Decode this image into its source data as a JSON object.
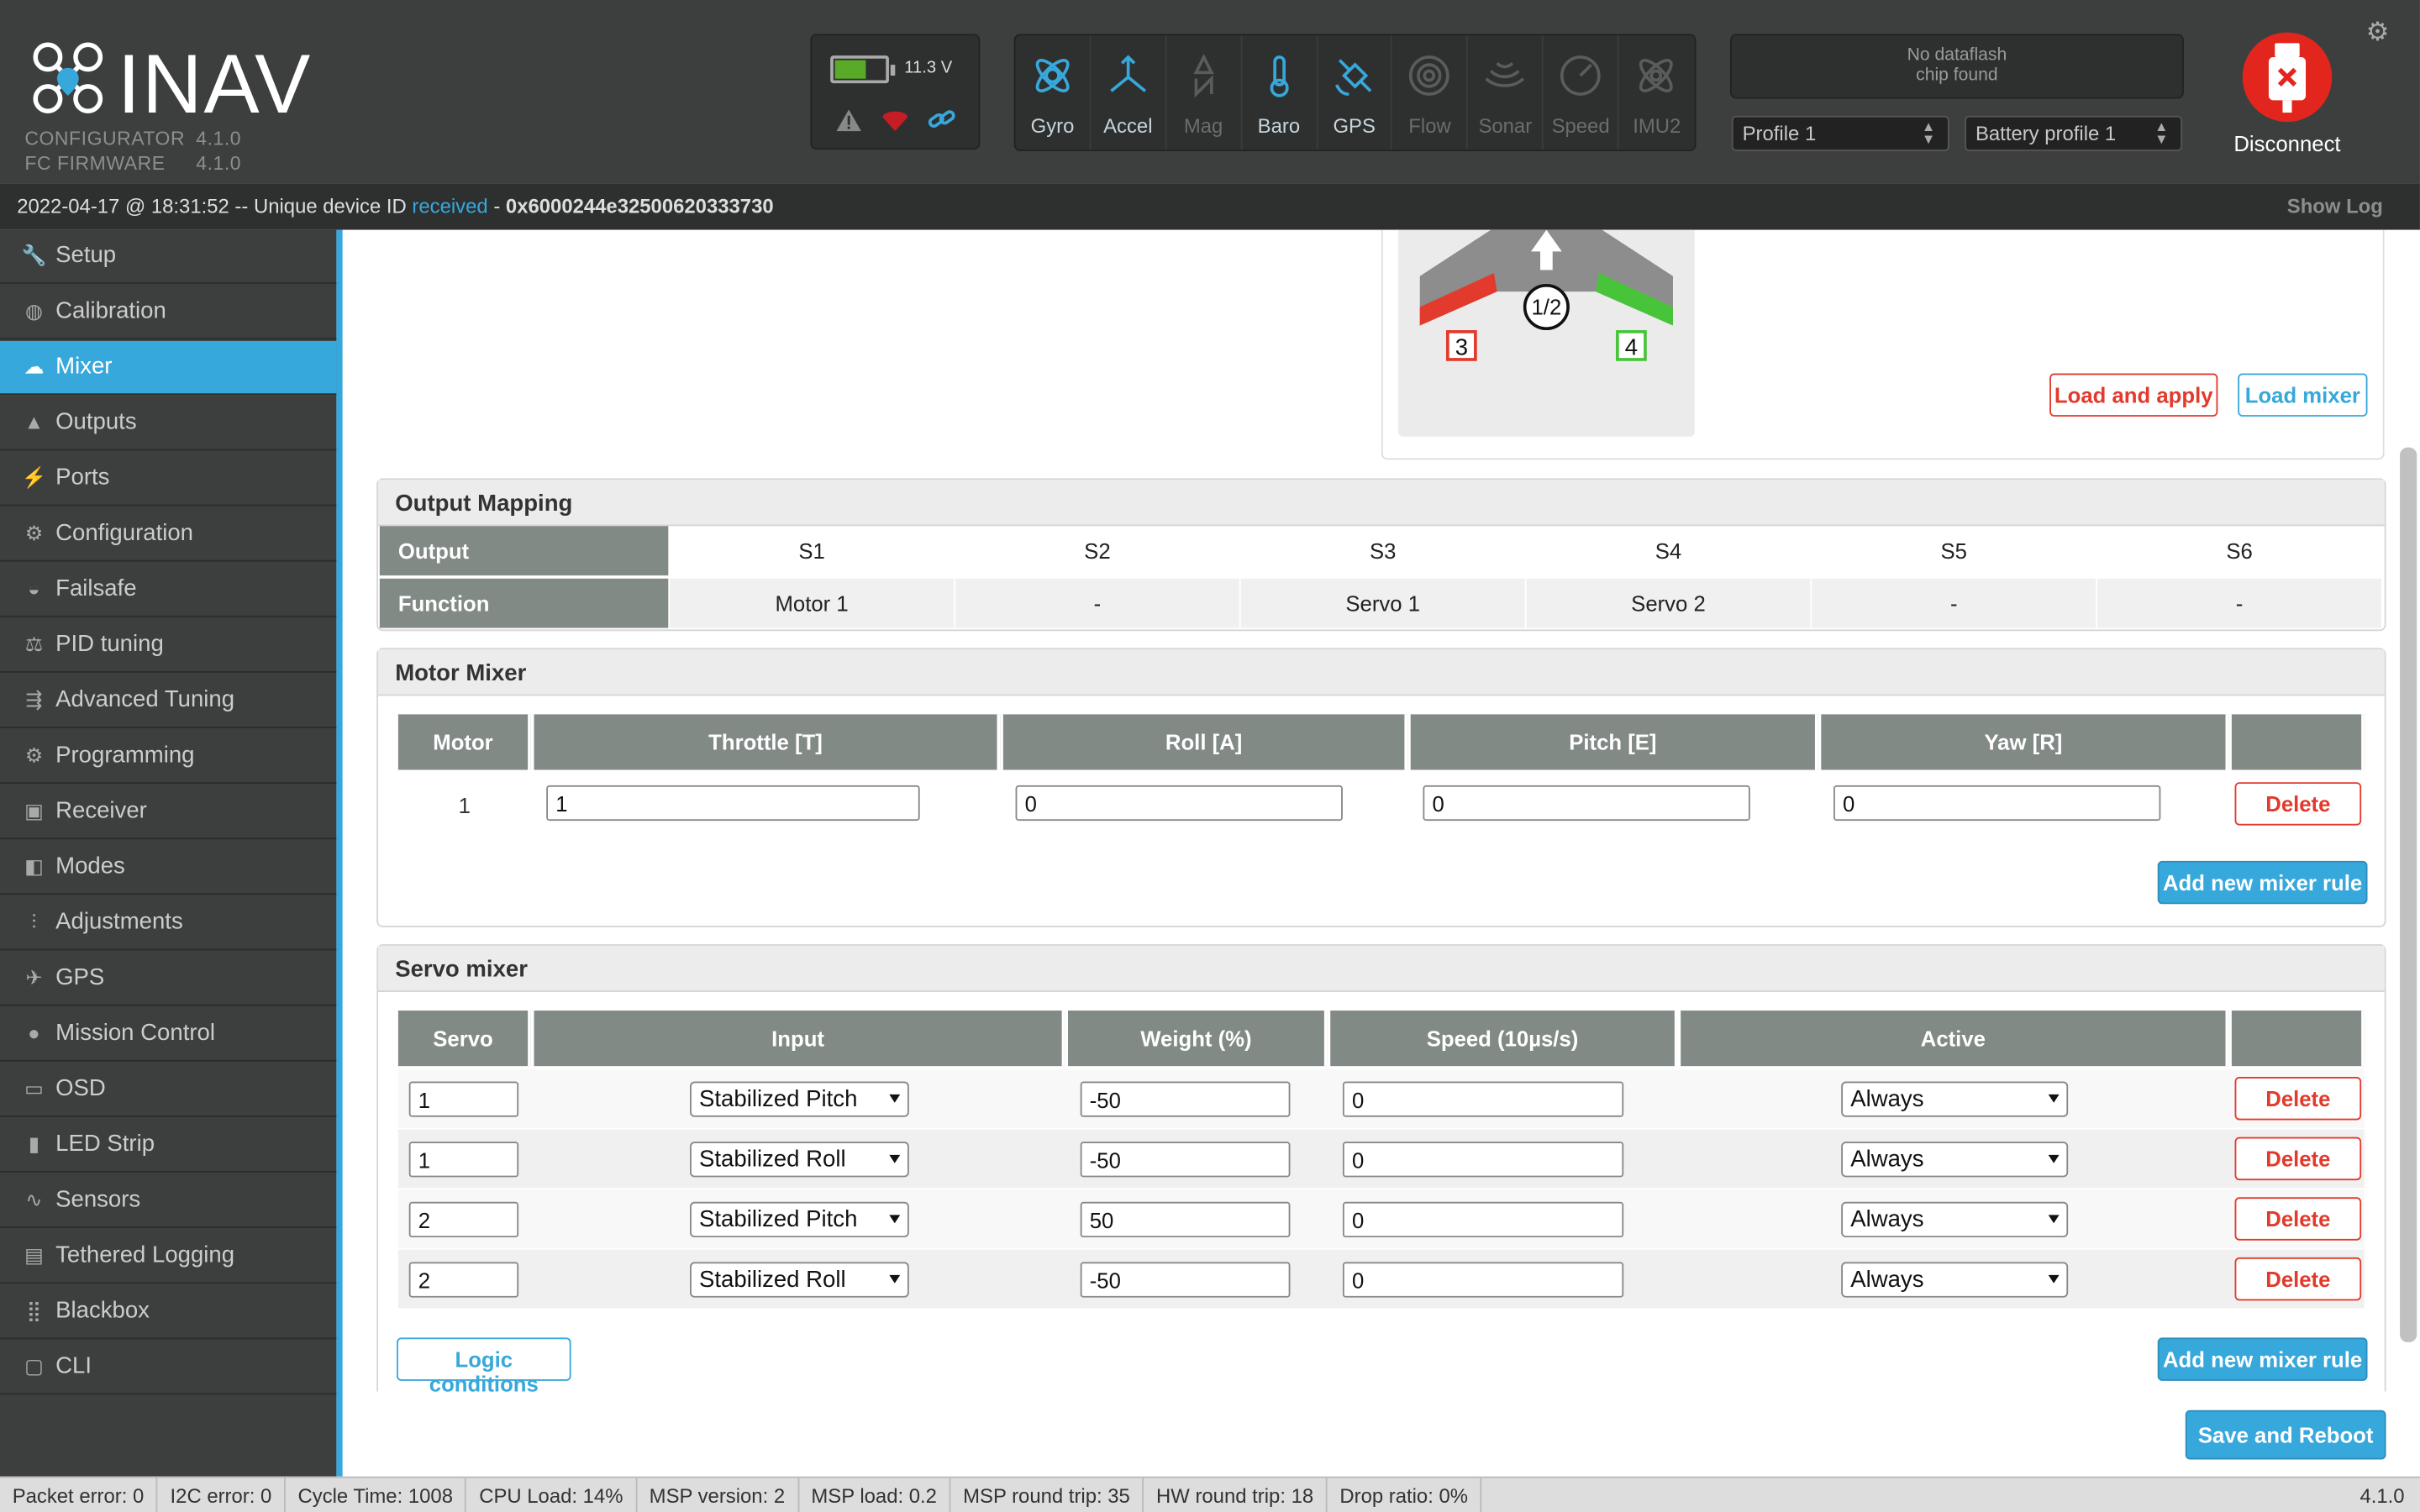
{
  "app": {
    "name": "INAV",
    "configurator_label": "CONFIGURATOR",
    "configurator_version": "4.1.0",
    "firmware_label": "FC FIRMWARE",
    "firmware_version": "4.1.0"
  },
  "battery": {
    "voltage": "11.3 V",
    "level": 0.55,
    "color": "#59aa29"
  },
  "sensors": [
    {
      "label": "Gyro",
      "icon": "gyro-icon",
      "active": true
    },
    {
      "label": "Accel",
      "icon": "accel-icon",
      "active": true
    },
    {
      "label": "Mag",
      "icon": "mag-icon",
      "active": false
    },
    {
      "label": "Baro",
      "icon": "baro-icon",
      "active": true
    },
    {
      "label": "GPS",
      "icon": "gps-icon",
      "active": true
    },
    {
      "label": "Flow",
      "icon": "flow-icon",
      "active": false
    },
    {
      "label": "Sonar",
      "icon": "sonar-icon",
      "active": false
    },
    {
      "label": "Speed",
      "icon": "speed-icon",
      "active": false
    },
    {
      "label": "IMU2",
      "icon": "imu2-icon",
      "active": false
    }
  ],
  "dataflash": {
    "line1": "No dataflash",
    "line2": "chip found"
  },
  "profile_select": "Profile 1",
  "battery_profile_select": "Battery profile 1",
  "connect": {
    "label": "Disconnect",
    "color": "#e2261e"
  },
  "status": {
    "date": "2022-04-17 @ 18:31:52 -- Unique device ID ",
    "received": "received",
    "sep": " - ",
    "device_id": "0x6000244e32500620333730",
    "show_log": "Show Log"
  },
  "nav": [
    {
      "label": "Setup",
      "icon": "wrench-icon",
      "active": false
    },
    {
      "label": "Calibration",
      "icon": "calibration-icon",
      "active": false
    },
    {
      "label": "Mixer",
      "icon": "mixer-icon",
      "active": true
    },
    {
      "label": "Outputs",
      "icon": "outputs-icon",
      "active": false
    },
    {
      "label": "Ports",
      "icon": "plug-icon",
      "active": false
    },
    {
      "label": "Configuration",
      "icon": "gear-icon",
      "active": false
    },
    {
      "label": "Failsafe",
      "icon": "parachute-icon",
      "active": false
    },
    {
      "label": "PID tuning",
      "icon": "pid-icon",
      "active": false
    },
    {
      "label": "Advanced Tuning",
      "icon": "advanced-icon",
      "active": false
    },
    {
      "label": "Programming",
      "icon": "programming-icon",
      "active": false
    },
    {
      "label": "Receiver",
      "icon": "receiver-icon",
      "active": false
    },
    {
      "label": "Modes",
      "icon": "modes-icon",
      "active": false
    },
    {
      "label": "Adjustments",
      "icon": "sliders-icon",
      "active": false
    },
    {
      "label": "GPS",
      "icon": "satellite-icon",
      "active": false
    },
    {
      "label": "Mission Control",
      "icon": "map-pin-icon",
      "active": false
    },
    {
      "label": "OSD",
      "icon": "osd-icon",
      "active": false
    },
    {
      "label": "LED Strip",
      "icon": "led-icon",
      "active": false
    },
    {
      "label": "Sensors",
      "icon": "pulse-icon",
      "active": false
    },
    {
      "label": "Tethered Logging",
      "icon": "keyboard-icon",
      "active": false
    },
    {
      "label": "Blackbox",
      "icon": "blackbox-icon",
      "active": false
    },
    {
      "label": "CLI",
      "icon": "terminal-icon",
      "active": false
    }
  ],
  "preview": {
    "motor_label": "1/2",
    "left_servo": "3",
    "right_servo": "4",
    "left_color": "#e23a2c",
    "right_color": "#48c43a"
  },
  "buttons": {
    "load_apply": "Load and apply",
    "load_mixer": "Load mixer",
    "add_rule": "Add new mixer rule",
    "logic": "Logic conditions",
    "save_reboot": "Save and Reboot",
    "delete": "Delete"
  },
  "output_mapping": {
    "title": "Output Mapping",
    "output_label": "Output",
    "function_label": "Function",
    "outputs": [
      "S1",
      "S2",
      "S3",
      "S4",
      "S5",
      "S6"
    ],
    "functions": [
      "Motor 1",
      "-",
      "Servo 1",
      "Servo 2",
      "-",
      "-"
    ]
  },
  "motor_mixer": {
    "title": "Motor Mixer",
    "headers": [
      "Motor",
      "Throttle [T]",
      "Roll [A]",
      "Pitch [E]",
      "Yaw [R]"
    ],
    "rows": [
      {
        "motor": "1",
        "throttle": "1",
        "roll": "0",
        "pitch": "0",
        "yaw": "0"
      }
    ]
  },
  "servo_mixer": {
    "title": "Servo mixer",
    "headers": [
      "Servo",
      "Input",
      "Weight (%)",
      "Speed (10µs/s)",
      "Active"
    ],
    "rows": [
      {
        "servo": "1",
        "input": "Stabilized Pitch",
        "weight": "-50",
        "speed": "0",
        "active": "Always"
      },
      {
        "servo": "1",
        "input": "Stabilized Roll",
        "weight": "-50",
        "speed": "0",
        "active": "Always"
      },
      {
        "servo": "2",
        "input": "Stabilized Pitch",
        "weight": "50",
        "speed": "0",
        "active": "Always"
      },
      {
        "servo": "2",
        "input": "Stabilized Roll",
        "weight": "-50",
        "speed": "0",
        "active": "Always"
      }
    ]
  },
  "footer": {
    "items": [
      "Packet error: 0",
      "I2C error: 0",
      "Cycle Time: 1008",
      "CPU Load: 14%",
      "MSP version: 2",
      "MSP load: 0.2",
      "MSP round trip: 35",
      "HW round trip: 18",
      "Drop ratio: 0%"
    ],
    "version": "4.1.0"
  }
}
